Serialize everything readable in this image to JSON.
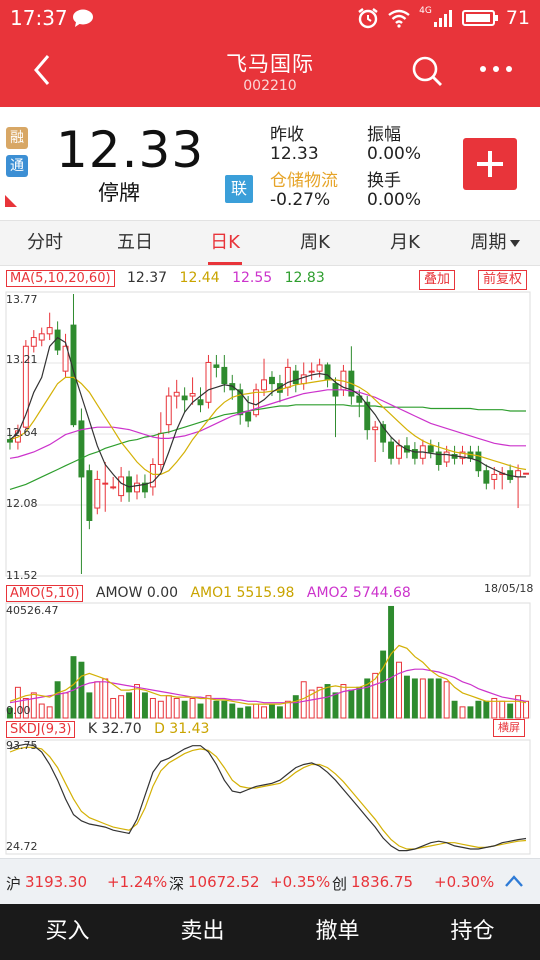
{
  "status_bar": {
    "time": "17:37",
    "battery": "71",
    "network": "4G"
  },
  "header": {
    "title": "飞马国际",
    "code": "002210"
  },
  "quote": {
    "badge_rong": "融",
    "badge_tong": "通",
    "price": "12.33",
    "trade_status": "停牌",
    "lian_badge": "联",
    "prev_close_label": "昨收",
    "prev_close": "12.33",
    "amplitude_label": "振幅",
    "amplitude": "0.00%",
    "sector": "仓储物流",
    "sector_change": "-0.27%",
    "turnover_label": "换手",
    "turnover": "0.00%"
  },
  "tabs": [
    {
      "label": "分时"
    },
    {
      "label": "五日"
    },
    {
      "label": "日K",
      "active": true
    },
    {
      "label": "周K"
    },
    {
      "label": "月K"
    },
    {
      "label": "周期"
    }
  ],
  "kline": {
    "ma_label": "MA(5,10,20,60)",
    "ma5": "12.37",
    "ma10": "12.44",
    "ma20": "12.55",
    "ma60": "12.83",
    "overlay_button": "叠加",
    "adjust_button": "前复权",
    "y_ticks": [
      "13.77",
      "13.21",
      "12.64",
      "12.08",
      "11.52"
    ],
    "date": "18/05/18"
  },
  "volume": {
    "label": "AMO(5,10)",
    "amow": "AMOW 0.00",
    "amo1": "AMO1 5515.98",
    "amo2": "AMO2 5744.68",
    "y_top": "40526.47",
    "y_bottom": "0.00"
  },
  "kdj": {
    "label": "SKDJ(9,3)",
    "k": "K 32.70",
    "d": "D 31.43",
    "y_top": "93.75",
    "y_bottom": "24.72",
    "switch_button": "横屏"
  },
  "ticker": {
    "sh_label": "沪",
    "sh_value": "3193.30",
    "sh_change": "+1.24%",
    "sz_label": "深",
    "sz_value": "10672.52",
    "sz_change": "+0.35%",
    "cy_label": "创",
    "cy_value": "1836.75",
    "cy_change": "+0.30%"
  },
  "bottom_nav": [
    "买入",
    "卖出",
    "撤单",
    "持仓"
  ],
  "colors": {
    "accent": "#e8343a",
    "up": "#e8343a",
    "down": "#2e8b2e",
    "ma5": "#333333",
    "ma10": "#d4b106",
    "ma20": "#cc33cc",
    "ma60": "#2e9e2e"
  },
  "chart_data": {
    "type": "candlestick",
    "price_range": [
      11.52,
      13.77
    ],
    "candles": [
      [
        12.6,
        12.58,
        12.64,
        12.52
      ],
      [
        12.58,
        12.67,
        12.72,
        12.52
      ],
      [
        12.7,
        13.35,
        13.4,
        12.68
      ],
      [
        13.35,
        13.42,
        13.48,
        13.3
      ],
      [
        13.4,
        13.45,
        13.5,
        13.35
      ],
      [
        13.45,
        13.5,
        13.62,
        13.4
      ],
      [
        13.48,
        13.32,
        13.55,
        13.28
      ],
      [
        13.15,
        13.35,
        13.45,
        13.1
      ],
      [
        13.52,
        12.72,
        13.77,
        12.7
      ],
      [
        12.75,
        12.3,
        12.85,
        11.52
      ],
      [
        12.35,
        11.95,
        12.4,
        11.88
      ],
      [
        12.05,
        12.28,
        12.35,
        12.0
      ],
      [
        12.25,
        12.25,
        12.42,
        12.02
      ],
      [
        12.22,
        12.22,
        12.3,
        12.2
      ],
      [
        12.15,
        12.3,
        12.38,
        12.1
      ],
      [
        12.3,
        12.18,
        12.35,
        12.1
      ],
      [
        12.18,
        12.25,
        12.32,
        12.12
      ],
      [
        12.25,
        12.18,
        12.32,
        12.13
      ],
      [
        12.22,
        12.4,
        12.45,
        12.15
      ],
      [
        12.4,
        12.65,
        12.82,
        12.35
      ],
      [
        12.72,
        12.95,
        13.02,
        12.65
      ],
      [
        12.95,
        12.98,
        13.08,
        12.85
      ],
      [
        12.95,
        12.92,
        13.02,
        12.82
      ],
      [
        12.95,
        12.97,
        13.1,
        12.88
      ],
      [
        12.92,
        12.88,
        13.02,
        12.82
      ],
      [
        12.9,
        13.22,
        13.28,
        12.85
      ],
      [
        13.2,
        13.18,
        13.28,
        13.1
      ],
      [
        13.18,
        13.05,
        13.28,
        12.98
      ],
      [
        13.05,
        13.0,
        13.12,
        12.92
      ],
      [
        13.0,
        12.8,
        13.05,
        12.72
      ],
      [
        12.82,
        12.75,
        12.95,
        12.7
      ],
      [
        12.8,
        13.0,
        13.05,
        12.78
      ],
      [
        13.0,
        13.08,
        13.25,
        12.95
      ],
      [
        13.1,
        13.05,
        13.15,
        12.95
      ],
      [
        13.05,
        12.98,
        13.12,
        12.9
      ],
      [
        13.02,
        13.18,
        13.25,
        12.95
      ],
      [
        13.15,
        13.05,
        13.2,
        12.98
      ],
      [
        13.05,
        13.12,
        13.22,
        13.0
      ],
      [
        13.15,
        13.15,
        13.22,
        13.08
      ],
      [
        13.15,
        13.2,
        13.25,
        13.1
      ],
      [
        13.2,
        13.08,
        13.22,
        13.02
      ],
      [
        13.05,
        12.95,
        13.1,
        12.62
      ],
      [
        13.0,
        13.15,
        13.2,
        12.95
      ],
      [
        13.15,
        12.95,
        13.35,
        12.88
      ],
      [
        12.95,
        12.9,
        13.0,
        12.78
      ],
      [
        12.9,
        12.68,
        12.95,
        12.6
      ],
      [
        12.68,
        12.7,
        12.75,
        12.42
      ],
      [
        12.72,
        12.58,
        12.75,
        12.5
      ],
      [
        12.58,
        12.45,
        12.62,
        12.4
      ],
      [
        12.45,
        12.55,
        12.6,
        12.4
      ],
      [
        12.55,
        12.5,
        12.62,
        12.45
      ],
      [
        12.52,
        12.45,
        12.58,
        12.4
      ],
      [
        12.45,
        12.55,
        12.6,
        12.4
      ],
      [
        12.55,
        12.5,
        12.6,
        12.45
      ],
      [
        12.5,
        12.4,
        12.58,
        12.35
      ],
      [
        12.42,
        12.5,
        12.55,
        12.38
      ],
      [
        12.48,
        12.45,
        12.55,
        12.4
      ],
      [
        12.45,
        12.5,
        12.55,
        12.4
      ],
      [
        12.5,
        12.45,
        12.55,
        12.42
      ],
      [
        12.5,
        12.35,
        12.55,
        12.3
      ],
      [
        12.35,
        12.25,
        12.4,
        12.2
      ],
      [
        12.28,
        12.32,
        12.38,
        12.2
      ],
      [
        12.32,
        12.33,
        12.38,
        12.2
      ],
      [
        12.35,
        12.28,
        12.4,
        12.25
      ],
      [
        12.3,
        12.35,
        12.4,
        12.05
      ],
      [
        12.33,
        12.33,
        12.33,
        12.33
      ]
    ],
    "ma5": [
      12.6,
      12.65,
      12.8,
      12.98,
      13.1,
      13.35,
      13.42,
      13.38,
      13.15,
      12.95,
      12.75,
      12.55,
      12.4,
      12.32,
      12.25,
      12.22,
      12.23,
      12.24,
      12.26,
      12.33,
      12.5,
      12.68,
      12.82,
      12.9,
      12.95,
      13.0,
      13.02,
      13.04,
      13.03,
      12.98,
      12.9,
      12.88,
      12.92,
      12.98,
      13.02,
      13.06,
      13.08,
      13.1,
      13.12,
      13.13,
      13.12,
      13.06,
      13.02,
      13.0,
      12.96,
      12.88,
      12.8,
      12.7,
      12.62,
      12.56,
      12.52,
      12.5,
      12.5,
      12.49,
      12.48,
      12.48,
      12.47,
      12.46,
      12.45,
      12.43,
      12.39,
      12.36,
      12.33,
      12.31,
      12.3,
      12.3
    ],
    "ma10": [
      12.6,
      12.62,
      12.66,
      12.75,
      12.85,
      12.95,
      13.05,
      13.1,
      13.1,
      13.05,
      12.98,
      12.88,
      12.78,
      12.68,
      12.58,
      12.5,
      12.42,
      12.36,
      12.32,
      12.32,
      12.35,
      12.42,
      12.5,
      12.6,
      12.68,
      12.76,
      12.84,
      12.9,
      12.94,
      12.96,
      12.97,
      12.98,
      12.98,
      12.99,
      13.0,
      13.02,
      13.04,
      13.05,
      13.06,
      13.07,
      13.08,
      13.08,
      13.07,
      13.05,
      13.02,
      12.98,
      12.92,
      12.86,
      12.8,
      12.74,
      12.68,
      12.63,
      12.59,
      12.56,
      12.54,
      12.52,
      12.5,
      12.49,
      12.48,
      12.47,
      12.45,
      12.43,
      12.41,
      12.39,
      12.37,
      12.36
    ],
    "ma20": [
      12.45,
      12.46,
      12.48,
      12.5,
      12.53,
      12.56,
      12.6,
      12.64,
      12.66,
      12.68,
      12.69,
      12.7,
      12.7,
      12.7,
      12.69,
      12.68,
      12.66,
      12.64,
      12.62,
      12.61,
      12.61,
      12.62,
      12.63,
      12.65,
      12.67,
      12.7,
      12.73,
      12.76,
      12.79,
      12.81,
      12.83,
      12.85,
      12.87,
      12.89,
      12.91,
      12.93,
      12.95,
      12.97,
      12.98,
      12.99,
      13.0,
      13.0,
      13.0,
      12.99,
      12.98,
      12.96,
      12.94,
      12.91,
      12.88,
      12.85,
      12.82,
      12.79,
      12.76,
      12.73,
      12.71,
      12.69,
      12.67,
      12.65,
      12.63,
      12.61,
      12.59,
      12.57,
      12.56,
      12.55,
      12.55,
      12.55
    ],
    "ma60": [
      12.2,
      12.22,
      12.24,
      12.27,
      12.3,
      12.33,
      12.36,
      12.39,
      12.42,
      12.45,
      12.48,
      12.5,
      12.53,
      12.55,
      12.57,
      12.59,
      12.6,
      12.62,
      12.63,
      12.65,
      12.66,
      12.68,
      12.7,
      12.72,
      12.74,
      12.76,
      12.78,
      12.8,
      12.81,
      12.82,
      12.83,
      12.84,
      12.85,
      12.86,
      12.87,
      12.87,
      12.88,
      12.88,
      12.88,
      12.88,
      12.88,
      12.88,
      12.88,
      12.87,
      12.87,
      12.87,
      12.87,
      12.86,
      12.86,
      12.86,
      12.86,
      12.86,
      12.86,
      12.85,
      12.85,
      12.85,
      12.85,
      12.85,
      12.85,
      12.84,
      12.84,
      12.84,
      12.84,
      12.83,
      12.83,
      12.83
    ],
    "volume_range": [
      0,
      40526.47
    ],
    "volume": [
      3500,
      11000,
      7000,
      9000,
      5000,
      4000,
      13000,
      9000,
      22000,
      20000,
      9000,
      13000,
      14000,
      7000,
      8000,
      9000,
      12000,
      9000,
      7000,
      6000,
      8000,
      7000,
      6000,
      7000,
      5000,
      8000,
      6000,
      6000,
      5000,
      3500,
      4000,
      5000,
      4000,
      5000,
      4000,
      6000,
      8000,
      13000,
      10000,
      11000,
      12000,
      9000,
      12000,
      10000,
      11000,
      14000,
      16000,
      24000,
      40000,
      20000,
      15000,
      14000,
      14000,
      14000,
      14000,
      13000,
      6000,
      4000,
      4000,
      6000,
      6000,
      7000,
      6000,
      5000,
      8000,
      6000
    ],
    "amo1": [
      6000,
      7000,
      8000,
      8500,
      8000,
      7500,
      9000,
      10000,
      12000,
      15000,
      16000,
      15000,
      14000,
      12000,
      10000,
      10000,
      10500,
      10000,
      9000,
      8000,
      8000,
      7500,
      7500,
      7500,
      7000,
      7000,
      6500,
      6500,
      6000,
      5500,
      5000,
      5000,
      5000,
      5000,
      5000,
      5500,
      6000,
      7000,
      8500,
      10000,
      11000,
      11500,
      11000,
      11000,
      11000,
      12000,
      14000,
      18000,
      23000,
      26000,
      25000,
      22000,
      20000,
      17000,
      15000,
      14000,
      11000,
      9000,
      8000,
      7000,
      6000,
      6000,
      6000,
      6000,
      6000,
      5500
    ],
    "amo2": [
      5500,
      6000,
      6500,
      7000,
      7500,
      8000,
      8500,
      9000,
      10000,
      11500,
      12500,
      13000,
      13000,
      12500,
      12000,
      11500,
      11000,
      10500,
      10000,
      9500,
      9000,
      8500,
      8000,
      7500,
      7500,
      7000,
      7000,
      7000,
      6500,
      6500,
      6000,
      6000,
      5500,
      5500,
      5500,
      5500,
      5500,
      6000,
      6500,
      7000,
      7500,
      8500,
      9500,
      10000,
      10500,
      11000,
      12000,
      13000,
      14500,
      16000,
      17000,
      17500,
      17500,
      17000,
      16500,
      15500,
      14500,
      13000,
      12000,
      10500,
      9500,
      8500,
      7500,
      7000,
      6500,
      6000
    ],
    "kdj_range": [
      24.72,
      93.75
    ],
    "k": [
      90,
      92,
      93,
      92,
      88,
      80,
      70,
      58,
      48,
      44,
      42,
      41,
      40,
      38,
      37,
      36,
      45,
      60,
      75,
      82,
      84,
      87,
      90,
      92,
      92,
      88,
      80,
      70,
      63,
      62,
      64,
      66,
      67,
      68,
      70,
      74,
      78,
      80,
      81,
      79,
      75,
      70,
      64,
      58,
      52,
      46,
      40,
      33,
      28,
      25,
      25,
      26,
      28,
      30,
      31,
      30,
      28,
      27,
      26,
      26,
      27,
      28,
      30,
      31,
      32,
      32.7
    ],
    "d": [
      88,
      90,
      91,
      91,
      90,
      85,
      78,
      68,
      58,
      50,
      46,
      44,
      42,
      40,
      39,
      38,
      42,
      52,
      66,
      76,
      81,
      84,
      87,
      89,
      90,
      89,
      85,
      78,
      70,
      66,
      65,
      65,
      66,
      67,
      68,
      71,
      75,
      78,
      80,
      80,
      78,
      74,
      69,
      63,
      57,
      51,
      45,
      38,
      32,
      28,
      26,
      26,
      27,
      28,
      29,
      30,
      30,
      29,
      28,
      27,
      27,
      28,
      29,
      30,
      31,
      31.43
    ]
  }
}
